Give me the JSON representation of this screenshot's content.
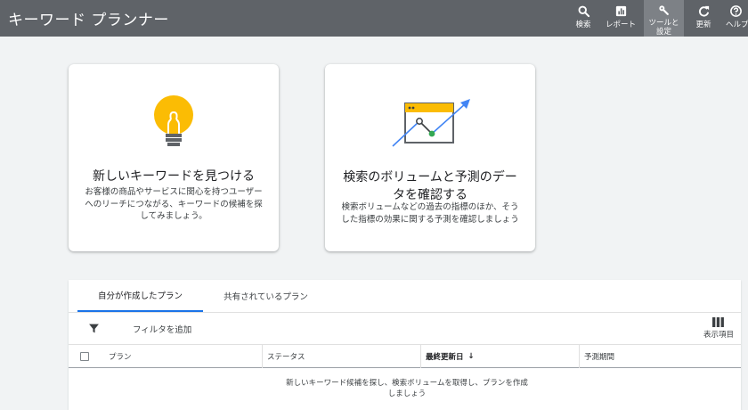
{
  "header": {
    "title": "キーワード プランナー",
    "nav": [
      {
        "label": "検索",
        "icon": "search-icon"
      },
      {
        "label": "レポート",
        "icon": "reports-icon"
      },
      {
        "label": "ツールと\n設定",
        "icon": "wrench-icon"
      },
      {
        "label": "更新",
        "icon": "refresh-icon"
      },
      {
        "label": "ヘルプ",
        "icon": "help-icon"
      }
    ]
  },
  "cards": {
    "discover": {
      "title": "新しいキーワードを見つける",
      "description": "お客様の商品やサービスに関心を持つユーザーへのリーチにつながる、キーワードの候補を探してみましょう。",
      "icon": "lightbulb-icon"
    },
    "forecast": {
      "title": "検索のボリュームと予測のデータを確認する",
      "description": "検索ボリュームなどの過去の指標のほか、そうした指標の効果に関する予測を確認しましょう",
      "icon": "trend-chart-icon"
    }
  },
  "plans": {
    "tabs": [
      "自分が作成したプラン",
      "共有されているプラン"
    ],
    "filter_label": "フィルタを追加",
    "columns_label": "表示項目",
    "columns": [
      "プラン",
      "ステータス",
      "最終更新日",
      "予測期間"
    ],
    "sort_arrow": "↓",
    "empty_message": "新しいキーワード候補を探し、検索ボリュームを取得し、プランを作成しましょう"
  },
  "colors": {
    "topbar": "#5f6368",
    "accent": "#1a73e8",
    "bulb": "#fbbc04",
    "trend_point": "#34a853",
    "trend_arrow": "#4285f4"
  }
}
